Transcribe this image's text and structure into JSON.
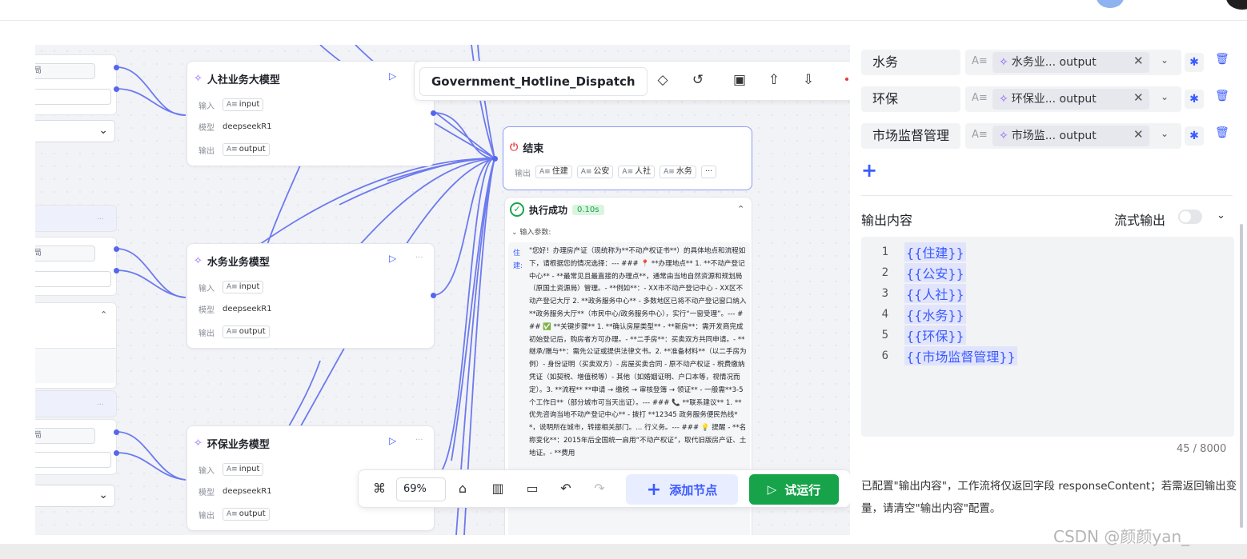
{
  "workflow": {
    "name": "Government_Hotline_Dispatch"
  },
  "left_fragments": {
    "label_a": "局",
    "label_b": "局",
    "label_c": "局",
    "more": "..."
  },
  "nodes": [
    {
      "title": "人社业务大模型",
      "input_label": "输入",
      "input_value": "input",
      "model_label": "模型",
      "model_value": "deepseekR1",
      "output_label": "输出",
      "output_value": "output"
    },
    {
      "title": "水务业务模型",
      "input_label": "输入",
      "input_value": "input",
      "model_label": "模型",
      "model_value": "deepseekR1",
      "output_label": "输出",
      "output_value": "output"
    },
    {
      "title": "环保业务模型",
      "input_label": "输入",
      "input_value": "input",
      "model_label": "模型",
      "model_value": "deepseekR1",
      "output_label": "输出",
      "output_value": "output"
    }
  ],
  "end_node": {
    "title": "结束",
    "output_label": "输出",
    "outputs": [
      "住建",
      "公安",
      "人社",
      "水务"
    ],
    "more": "···"
  },
  "execution": {
    "status": "执行成功",
    "time": "0.10s",
    "input_params_label": "输入参数:",
    "key": "住建:",
    "text": "\"您好！办理房产证（现统称为**不动产权证书**）的具体地点和流程如下，请根据您的情况选择：--- ### 📍 **办理地点** 1. **不动产登记中心** - **最常见且最直接的办理点**，通常由当地自然资源和规划局（原国土资源局）管理。- **例如**：- XX市不动产登记中心 - XX区不动产登记大厅 2. **政务服务中心** - 多数地区已将不动产登记窗口纳入**政务服务大厅**（市民中心/政务服务中心），实行“一窗受理”。--- ### ✅ **关键步骤** 1. **确认房屋类型** - **新房**：需开发商完成初始登记后，购房者方可办理。- **二手房**：买卖双方共同申请。- **继承/赠与**：需先公证或提供法律文书。2. **准备材料**（以二手房为例）- 身份证明（买卖双方）- 房屋买卖合同 - 原不动产权证 - 税费缴纳凭证（如契税、增值税等）- 其他（如婚姻证明、户口本等，视情况而定）。3. **流程** **申请 → 缴税 → 审核登簿 → 领证** - 一般需**3-5个工作日**（部分城市可当天出证）。--- ### 📞 **联系建议** 1. **优先咨询当地不动产登记中心** - 拨打 **12345 政务服务便民热线**，说明所在城市，转接相关部门。... 行义务。--- ### 💡 提醒 - **名称变化**：2015年后全国统一启用“不动产权证”，取代旧版房产证、土地证。- **费用"
  },
  "toolbar_bottom": {
    "zoom": "69%",
    "add_node": "添加节点",
    "trial_run": "试运行"
  },
  "right_panel": {
    "variables": [
      {
        "name": "水务",
        "ref": "水务业...",
        "field": "output"
      },
      {
        "name": "环保",
        "ref": "环保业...",
        "field": "output"
      },
      {
        "name": "市场监督管理",
        "ref": "市场监...",
        "field": "output"
      }
    ],
    "output_content_label": "输出内容",
    "stream_output_label": "流式输出",
    "code_lines": [
      "{{住建}}",
      "{{公安}}",
      "{{人社}}",
      "{{水务}}",
      "{{环保}}",
      "{{市场监督管理}}"
    ],
    "counter": "45 / 8000",
    "hint": "已配置\"输出内容\"，工作流将仅返回字段 responseContent；若需返回输出变量，请清空\"输出内容\"配置。"
  },
  "watermark": "CSDN @颜颜yan_",
  "colors": {
    "accent": "#3b5bfd",
    "success": "#16a34a",
    "edge": "#5566ee",
    "sparkle": "#8b5cf6"
  }
}
